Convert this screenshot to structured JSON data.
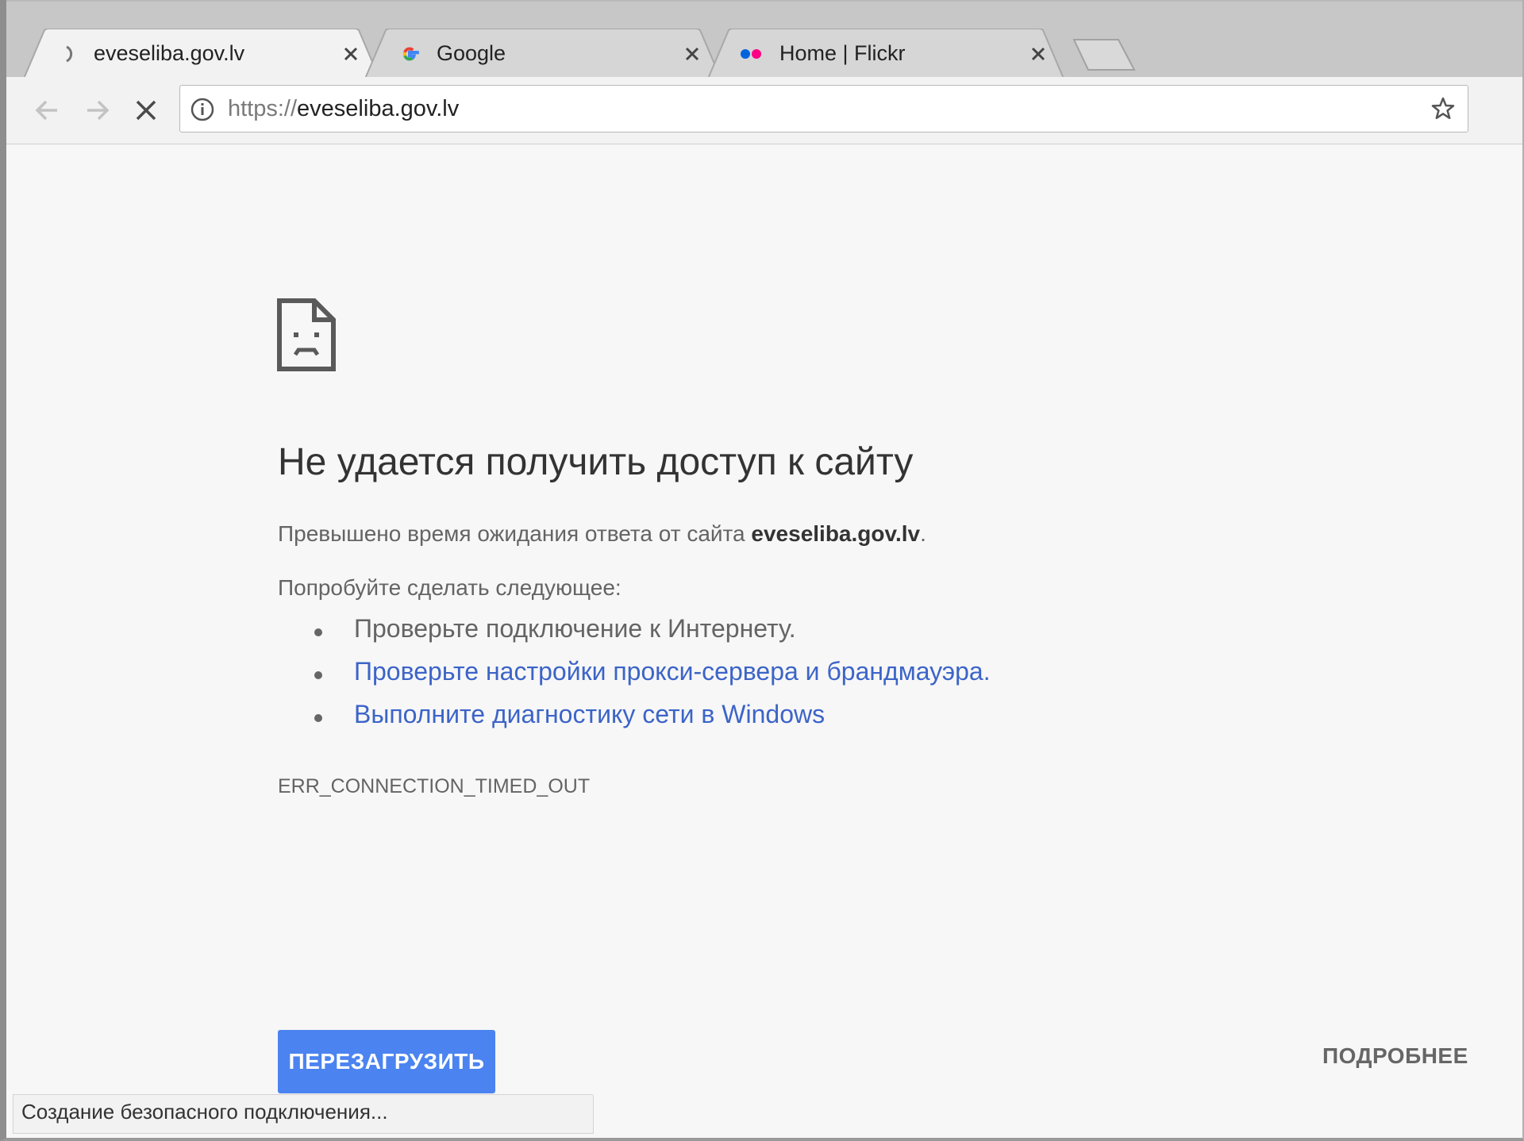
{
  "tabs": [
    {
      "title": "eveseliba.gov.lv",
      "favicon": "loading-spinner-icon",
      "active": true
    },
    {
      "title": "Google",
      "favicon": "google-g-icon",
      "active": false
    },
    {
      "title": "Home | Flickr",
      "favicon": "flickr-dots-icon",
      "active": false
    }
  ],
  "toolbar": {
    "back": "back-arrow-icon",
    "forward": "forward-arrow-icon",
    "stop": "stop-icon",
    "url_scheme": "https://",
    "url_host": "eveseliba.gov.lv",
    "info": "info-icon",
    "bookmark": "star-icon"
  },
  "error": {
    "icon": "sad-page-icon",
    "title": "Не удается получить доступ к сайту",
    "desc_prefix": "Превышено время ожидания ответа от сайта ",
    "desc_host": "eveseliba.gov.lv",
    "desc_suffix": ".",
    "suggest_heading": "Попробуйте сделать следующее:",
    "suggestions": [
      {
        "text": "Проверьте подключение к Интернету.",
        "link": false
      },
      {
        "text": "Проверьте настройки прокси-сервера и брандмауэра.",
        "link": true
      },
      {
        "text": "Выполните диагностику сети в Windows",
        "link": true
      }
    ],
    "code": "ERR_CONNECTION_TIMED_OUT",
    "reload_label": "ПЕРЕЗАГРУЗИТЬ",
    "details_label": "ПОДРОБНЕЕ"
  },
  "status_bar": "Создание безопасного подключения...",
  "colors": {
    "reload_button": "#4b84f0",
    "link": "#3c64c8",
    "flickr_blue": "#0063dc",
    "flickr_pink": "#ff0084"
  }
}
